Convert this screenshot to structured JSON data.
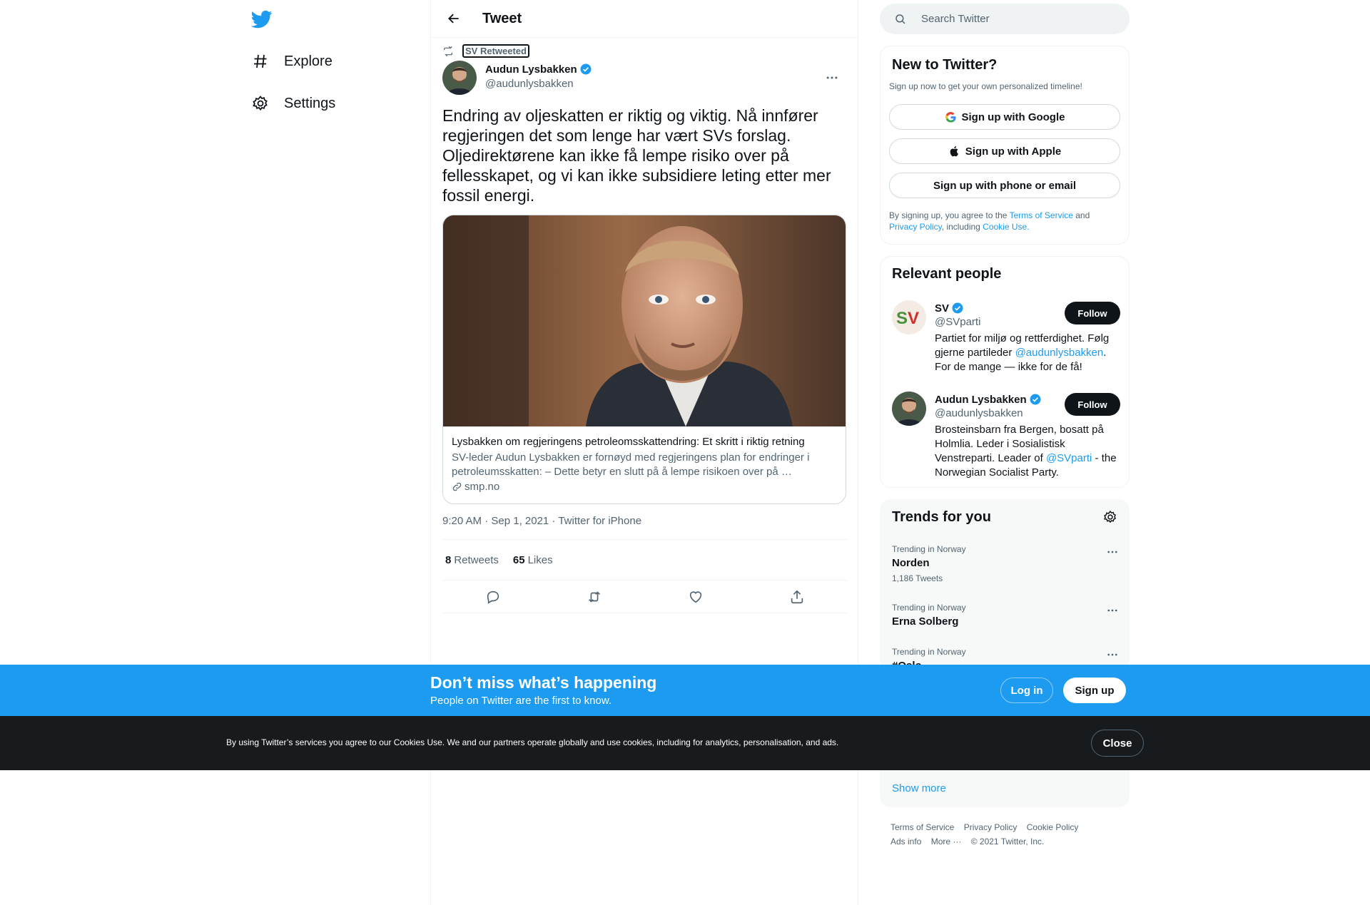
{
  "nav": {
    "items": [
      {
        "label": "Explore",
        "icon": "hashtag-icon"
      },
      {
        "label": "Settings",
        "icon": "gear-icon"
      }
    ]
  },
  "header": {
    "title": "Tweet"
  },
  "tweet": {
    "retweeted_by": "SV Retweeted",
    "author_name": "Audun Lysbakken",
    "author_handle": "@audunlysbakken",
    "text": "Endring av oljeskatten er riktig og viktig. Nå innfører regjeringen det som lenge har vært SVs forslag. Oljedirektørene kan ikke få lempe risiko over på fellesskapet, og vi kan ikke subsidiere leting etter mer fossil energi.",
    "card": {
      "title": "Lysbakken om regjeringens petroleomsskattendring: Et skritt i riktig retning",
      "description": "SV-leder Audun Lysbakken er fornøyd med regjeringens plan for endringer i petroleumsskatten: – Dette betyr en slutt på å lempe risikoen over på …",
      "domain": "smp.no"
    },
    "timestamp": "9:20 AM · Sep 1, 2021 · Twitter for iPhone",
    "retweets_count": "8",
    "retweets_label": "Retweets",
    "likes_count": "65",
    "likes_label": "Likes"
  },
  "search": {
    "placeholder": "Search Twitter"
  },
  "new_to_twitter": {
    "title": "New to Twitter?",
    "subtitle": "Sign up now to get your own personalized timeline!",
    "google": "Sign up with Google",
    "apple": "Sign up with Apple",
    "phone": "Sign up with phone or email",
    "legal_1": "By signing up, you agree to the ",
    "terms": "Terms of Service",
    "legal_2": " and ",
    "privacy": "Privacy Policy",
    "legal_3": ", including ",
    "cookie": "Cookie Use."
  },
  "relevant": {
    "title": "Relevant people",
    "people": [
      {
        "name": "SV",
        "handle": "@SVparti",
        "bio_1": "Partiet for miljø og rettferdighet. Følg gjerne partileder ",
        "bio_link": "@audunlysbakken",
        "bio_2": ". For de mange — ikke for de få!",
        "follow": "Follow"
      },
      {
        "name": "Audun Lysbakken",
        "handle": "@audunlysbakken",
        "bio_1": "Brosteinsbarn fra Bergen, bosatt på Holmlia. Leder i Sosialistisk Venstreparti. Leader of ",
        "bio_link": "@SVparti",
        "bio_2": " - the Norwegian Socialist Party.",
        "follow": "Follow"
      }
    ]
  },
  "trends": {
    "title": "Trends for you",
    "items": [
      {
        "context": "Trending in Norway",
        "name": "Norden",
        "count": "1,186 Tweets"
      },
      {
        "context": "Trending in Norway",
        "name": "Erna Solberg",
        "count": ""
      },
      {
        "context": "Trending in Norway",
        "name": "#Oslo",
        "count": ""
      }
    ],
    "show_more": "Show more"
  },
  "footer": {
    "links": [
      "Terms of Service",
      "Privacy Policy",
      "Cookie Policy",
      "Ads info",
      "More ···",
      "© 2021 Twitter, Inc."
    ]
  },
  "login_bar": {
    "heading": "Don’t miss what’s happening",
    "sub": "People on Twitter are the first to know.",
    "login": "Log in",
    "signup": "Sign up"
  },
  "cookie_bar": {
    "text": "By using Twitter’s services you agree to our Cookies Use. We and our partners operate globally and use cookies, including for analytics, personalisation, and ads.",
    "close": "Close"
  },
  "colors": {
    "accent": "#1d9bf0",
    "text": "#0f1419",
    "muted": "#536471",
    "cookie_bg": "#181b1e"
  }
}
